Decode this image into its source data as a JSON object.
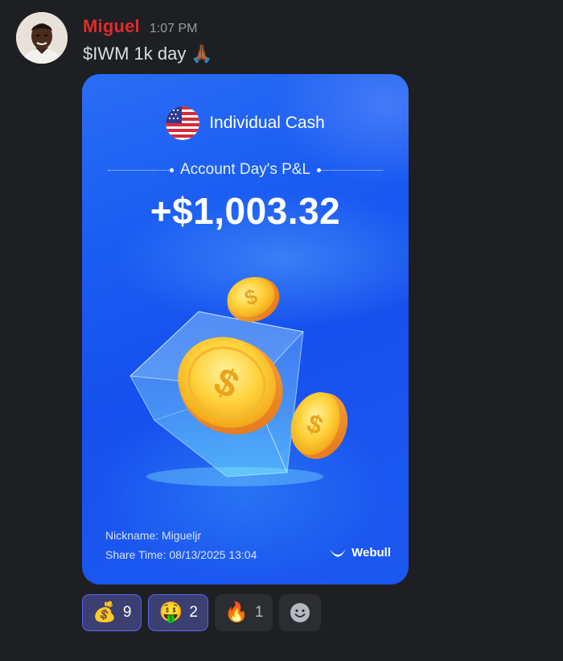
{
  "message": {
    "username": "Miguel",
    "timestamp": "1:07 PM",
    "text": "$IWM 1k day",
    "text_emoji": "🙏🏾",
    "username_color": "#e02b2b"
  },
  "card": {
    "account_name": "Individual Cash",
    "pl_label": "Account Day's P&L",
    "pl_value": "+$1,003.32",
    "nickname": "Nickname: Migueljr",
    "share_time": "Share Time: 08/13/2025 13:04",
    "brand": "Webull",
    "background_color": "#1a5cf2"
  },
  "reactions": [
    {
      "emoji": "💰",
      "count": "9",
      "active": true
    },
    {
      "emoji": "🤑",
      "count": "2",
      "active": true
    },
    {
      "emoji": "🔥",
      "count": "1",
      "active": false
    }
  ],
  "icons": {
    "avatar": "user-avatar",
    "flag": "us-flag-icon",
    "brand_logo": "webull-logo-icon",
    "add_reaction": "add-reaction-icon"
  },
  "colors": {
    "accent": "#5865f2",
    "background": "#1e1f22"
  }
}
